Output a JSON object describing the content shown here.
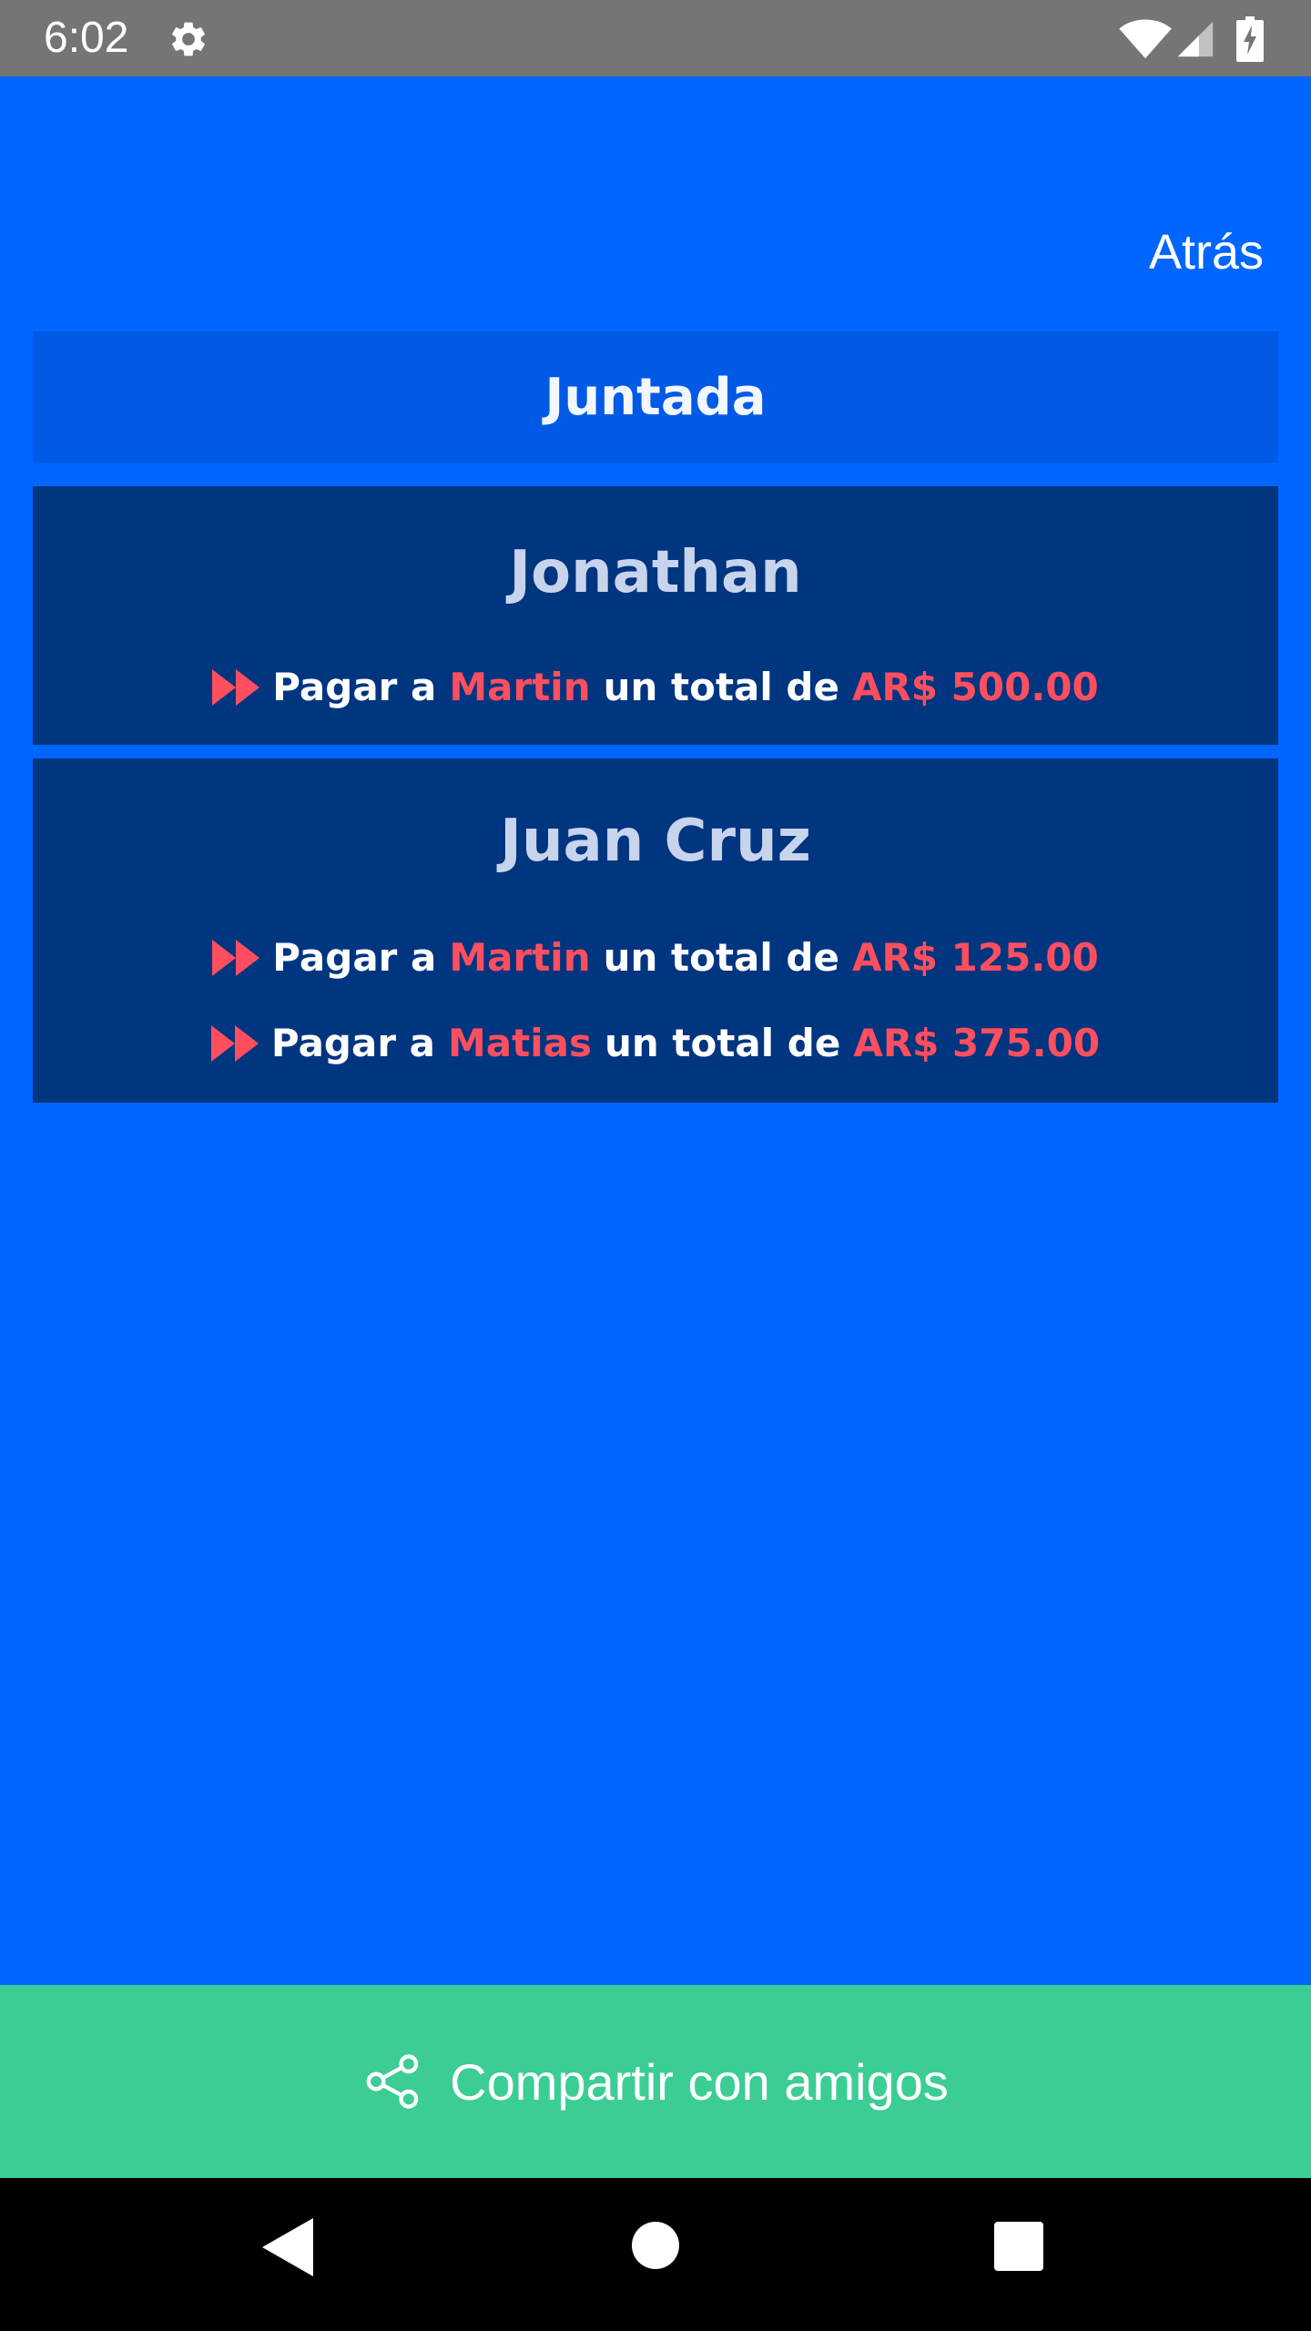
{
  "status_bar": {
    "time": "6:02",
    "icons": [
      "gear-icon",
      "wifi-icon",
      "cell-signal-icon",
      "battery-charging-icon"
    ]
  },
  "header": {
    "back_label": "Atrás",
    "event_title": "Juntada"
  },
  "people": [
    {
      "name": "Jonathan",
      "payments": [
        {
          "prefix": "Pagar a",
          "to": "Martin",
          "middle": "un total de",
          "amount": "AR$ 500.00"
        }
      ]
    },
    {
      "name": "Juan Cruz",
      "payments": [
        {
          "prefix": "Pagar a",
          "to": "Martin",
          "middle": "un total de",
          "amount": "AR$ 125.00"
        },
        {
          "prefix": "Pagar a",
          "to": "Matias",
          "middle": "un total de",
          "amount": "AR$ 375.00"
        }
      ]
    }
  ],
  "share": {
    "label": "Compartir con amigos",
    "icon": "share-icon"
  },
  "nav_bar": {
    "icons": [
      "back-triangle-icon",
      "home-circle-icon",
      "recents-square-icon"
    ]
  },
  "colors": {
    "background": "#0066ff",
    "header_panel": "#005ae6",
    "card": "#003580",
    "highlight": "#ff4f5e",
    "share_button": "#3ccd95",
    "status_bar": "#757575"
  }
}
